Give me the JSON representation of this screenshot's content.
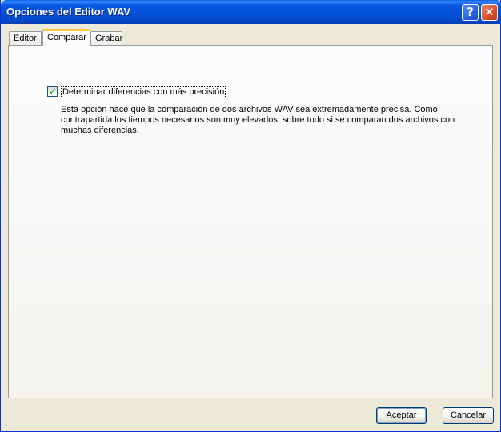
{
  "window": {
    "title": "Opciones del Editor WAV"
  },
  "titlebar": {
    "help_glyph": "?",
    "close_glyph": "✕"
  },
  "tabs": [
    {
      "label": "Editor",
      "active": false
    },
    {
      "label": "Comparar",
      "active": true
    },
    {
      "label": "Grabar",
      "active": false
    }
  ],
  "compare": {
    "checkbox_checked": true,
    "check_glyph": "✓",
    "checkbox_label": "Determinar diferencias con más precisión",
    "description": "Esta opción hace que la comparación de dos archivos WAV sea extremadamente precisa. Como contrapartida los tiempos necesarios son muy elevados, sobre todo si se comparan dos archivos con muchas diferencias."
  },
  "buttons": {
    "ok": "Aceptar",
    "cancel": "Cancelar"
  },
  "colors": {
    "titlebar": "#0551D8",
    "active_tab_accent": "#FFC83C",
    "check": "#21A121"
  }
}
